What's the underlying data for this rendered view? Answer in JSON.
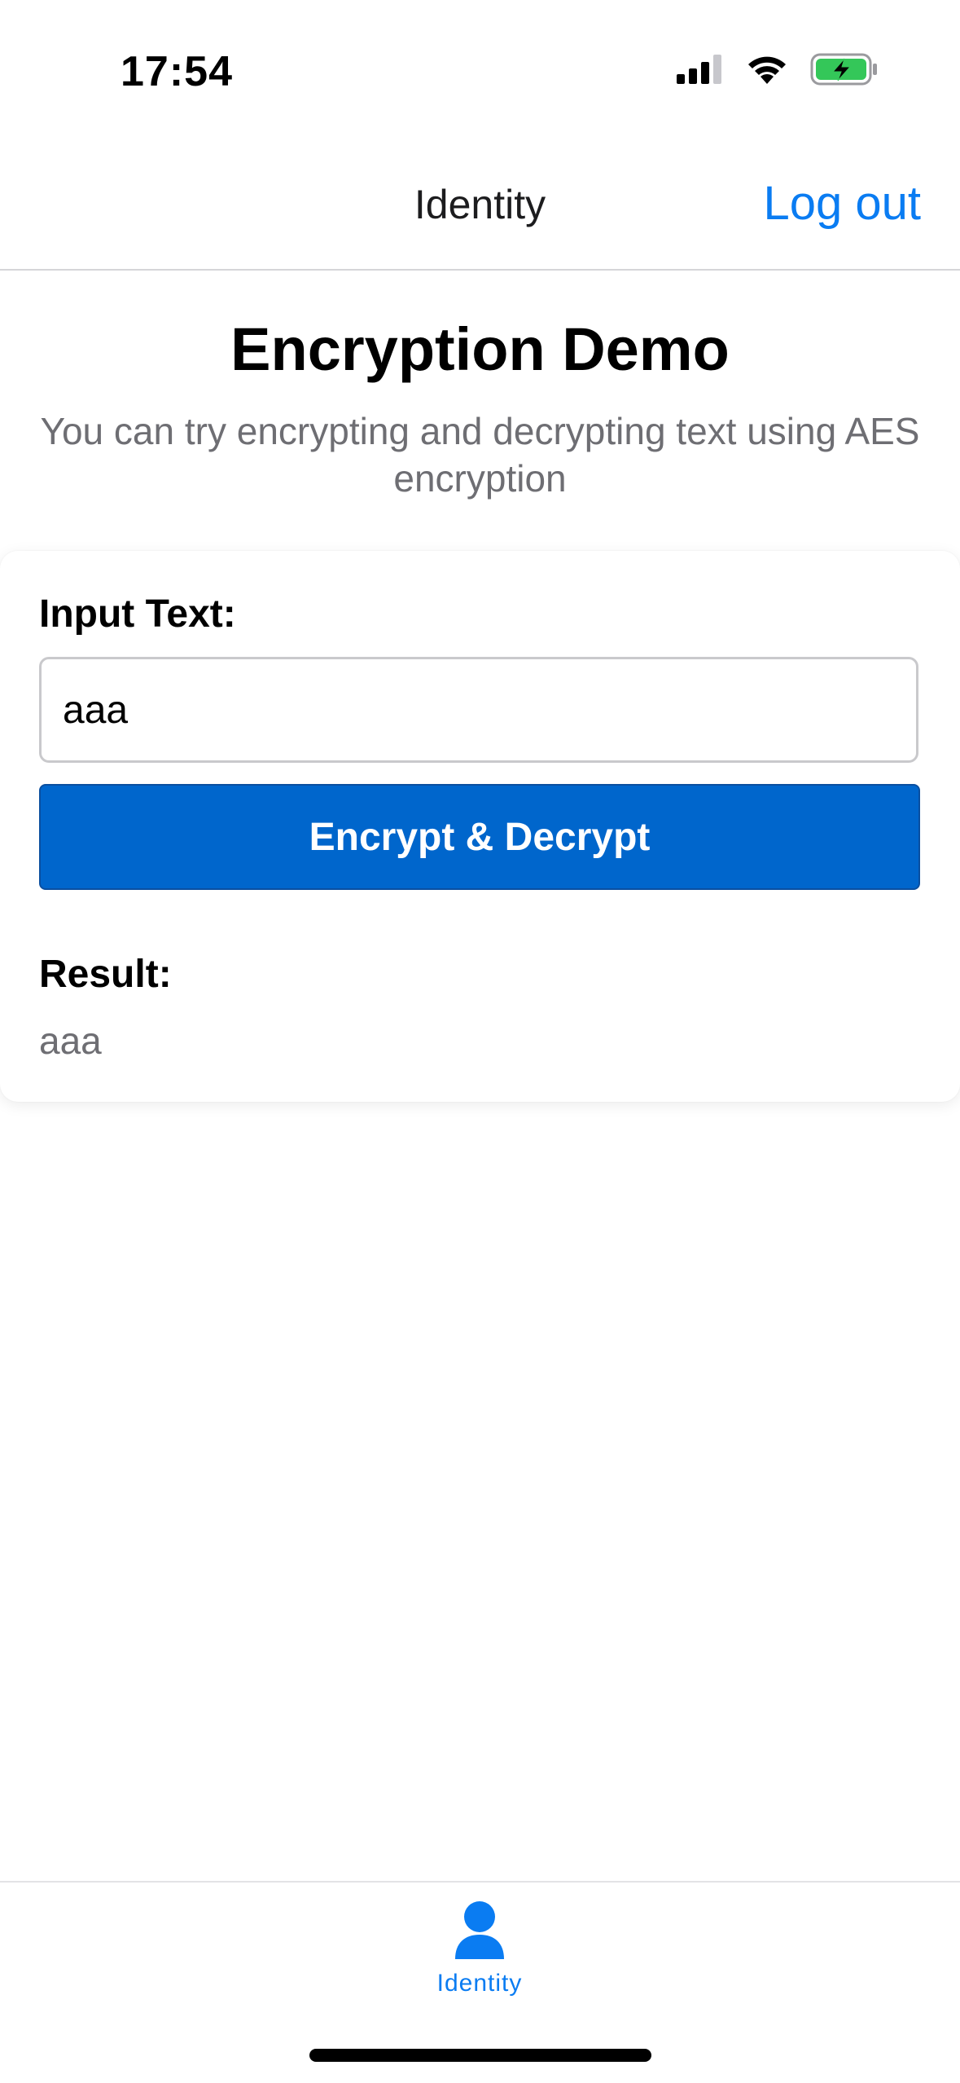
{
  "status_bar": {
    "time": "17:54",
    "icons": [
      "cellular-signal-icon",
      "wifi-icon",
      "battery-charging-icon"
    ],
    "battery_color": "#34c759"
  },
  "nav": {
    "title": "Identity",
    "logout_label": "Log out"
  },
  "header": {
    "title": "Encryption Demo",
    "subtitle": "You can try encrypting and decrypting text using AES encryption"
  },
  "form": {
    "input_label": "Input Text:",
    "input_value": "aaa",
    "button_label": "Encrypt & Decrypt",
    "result_label": "Result:",
    "result_value": "aaa"
  },
  "tab_bar": {
    "items": [
      {
        "label": "Identity",
        "icon": "person-icon",
        "active": true
      }
    ]
  },
  "colors": {
    "accent": "#0a7cf2",
    "button": "#0066cc",
    "secondary_text": "#6e6e73"
  }
}
